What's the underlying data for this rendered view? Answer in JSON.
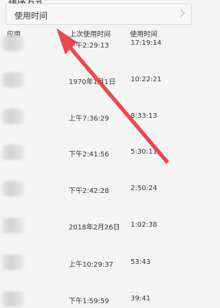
{
  "sort": {
    "label": "排序方式：",
    "value": "使用时间"
  },
  "columns": {
    "app": "应用",
    "last_used": "上次使用时间",
    "usage_time": "使用时间"
  },
  "rows": [
    {
      "last_used": "下午2:29:13",
      "usage_time": "17:19:14"
    },
    {
      "last_used": "1970年1月1日",
      "usage_time": "10:22:21"
    },
    {
      "last_used": "上午7:36:29",
      "usage_time": "8:33:13"
    },
    {
      "last_used": "下午2:41:56",
      "usage_time": "5:30:11"
    },
    {
      "last_used": "下午2:42:28",
      "usage_time": "2:50:24"
    },
    {
      "last_used": "2018年2月26日",
      "usage_time": "1:02:38"
    },
    {
      "last_used": "上午10:29:37",
      "usage_time": "53:43"
    },
    {
      "last_used": "下午1:59:59",
      "usage_time": "39:41"
    }
  ],
  "colors": {
    "annotation_arrow": "#e8393f",
    "background": "#f4f4f4"
  }
}
